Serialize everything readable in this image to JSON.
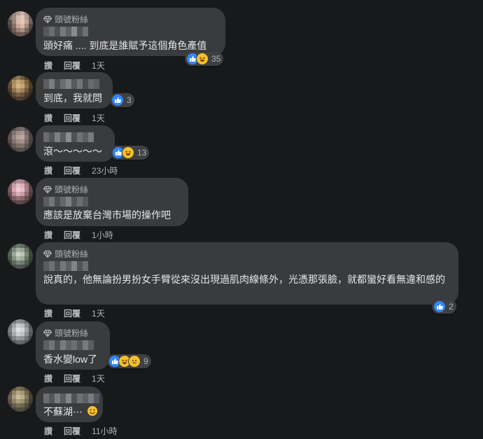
{
  "comments": [
    {
      "badge": "頭號粉絲",
      "text": "頭好痛 .... 到底是誰賦予這個角色產值",
      "reaction_count": "35",
      "actions": {
        "like": "讚",
        "reply": "回覆",
        "time": "1天"
      }
    },
    {
      "badge": "",
      "text": "到底，我就問",
      "reaction_count": "3",
      "actions": {
        "like": "讚",
        "reply": "回覆",
        "time": "1天"
      }
    },
    {
      "badge": "",
      "text": "滾～～～～～",
      "reaction_count": "13",
      "actions": {
        "like": "讚",
        "reply": "回覆",
        "time": "23小時"
      }
    },
    {
      "badge": "頭號粉絲",
      "text": "應該是放棄台灣市場的操作吧",
      "reaction_count": "",
      "actions": {
        "like": "讚",
        "reply": "回覆",
        "time": "1小時"
      }
    },
    {
      "badge": "頭號粉絲",
      "text": "說真的，他無論扮男扮女手臂從來沒出現過肌肉線條外，光憑那張臉，就都蠻好看無違和感的",
      "reaction_count": "2",
      "actions": {
        "like": "讚",
        "reply": "回覆",
        "time": "1天"
      }
    },
    {
      "badge": "頭號粉絲",
      "text": "香水變low了",
      "reaction_count": "9",
      "actions": {
        "like": "讚",
        "reply": "回覆",
        "time": "1天"
      }
    },
    {
      "badge": "",
      "text": "不蘇湖⋯",
      "reaction_count": "",
      "actions": {
        "like": "讚",
        "reply": "回覆",
        "time": "11小時"
      }
    }
  ],
  "colors": {
    "background": "#18191a",
    "bubble": "#3a3b3c",
    "text": "#e4e6eb",
    "muted": "#b0b3b8",
    "like_blue": "#2e89ff",
    "emoji_yellow": "#f7c02b"
  },
  "icons": {
    "badge": "diamond-icon",
    "like": "thumbs-up-icon",
    "haha": "laughing-face-icon",
    "sad": "sad-face-icon",
    "smile": "smile-emoji-icon"
  }
}
